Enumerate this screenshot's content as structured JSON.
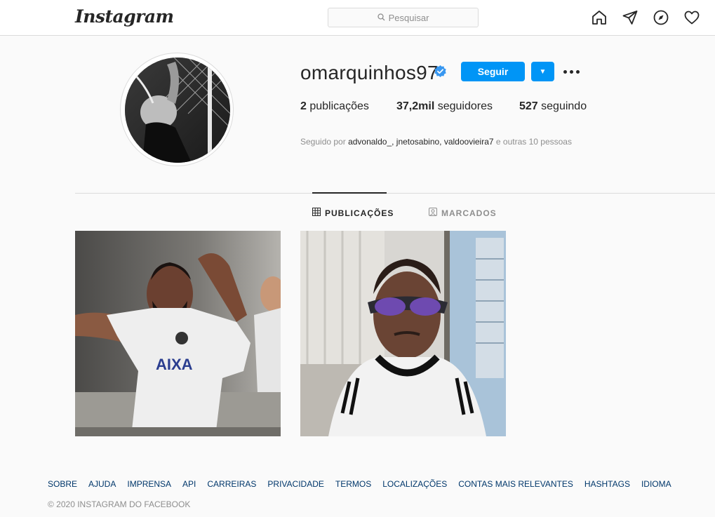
{
  "header": {
    "logo": "Instagram",
    "search_placeholder": "Pesquisar",
    "icons": [
      "home-icon",
      "direct-icon",
      "explore-icon",
      "activity-heart-icon"
    ]
  },
  "profile": {
    "username": "omarquinhos97",
    "verified": true,
    "follow_label": "Seguir",
    "stats": {
      "posts_count": "2",
      "posts_label": "publicações",
      "followers_count": "37,2mil",
      "followers_label": "seguidores",
      "following_count": "527",
      "following_label": "seguindo"
    },
    "followed_by_prefix": "Seguido por",
    "followed_by_names": "advonaldo_, jnetosabino, valdoovieira7",
    "followed_by_suffix": "e outras 10 pessoas"
  },
  "tabs": [
    {
      "label": "PUBLICAÇÕES",
      "active": true
    },
    {
      "label": "MARCADOS",
      "active": false
    }
  ],
  "footer": {
    "links": [
      "SOBRE",
      "AJUDA",
      "IMPRENSA",
      "API",
      "CARREIRAS",
      "PRIVACIDADE",
      "TERMOS",
      "LOCALIZAÇÕES",
      "CONTAS MAIS RELEVANTES",
      "HASHTAGS",
      "IDIOMA"
    ],
    "copyright": "© 2020 INSTAGRAM DO FACEBOOK"
  },
  "colors": {
    "accent": "#0095f6",
    "verified": "#3897f0",
    "border": "#dbdbdb",
    "link": "#00376b",
    "muted": "#8e8e8e"
  }
}
